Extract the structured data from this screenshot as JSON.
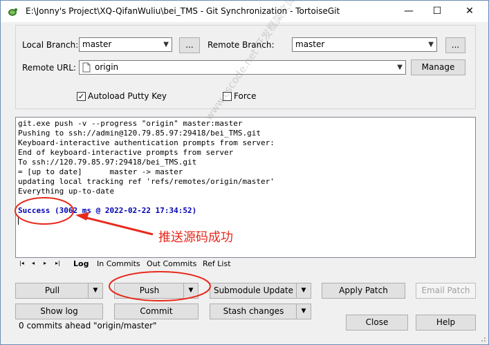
{
  "window": {
    "title": "E:\\Jonny's Project\\XQ-QifanWuliu\\bei_TMS - Git Synchronization - TortoiseGit",
    "minimize_glyph": "—",
    "maximize_glyph": "☐",
    "close_glyph": "✕"
  },
  "branch": {
    "local_label": "Local Branch:",
    "local_value": "master",
    "browse_label": "...",
    "remote_label": "Remote Branch:",
    "remote_value": "master",
    "remote_browse_label": "..."
  },
  "remote_url": {
    "label": "Remote URL:",
    "value": "origin",
    "manage_label": "Manage"
  },
  "options": {
    "autoload_label": "Autoload Putty Key",
    "autoload_checked": true,
    "force_label": "Force",
    "force_checked": false
  },
  "log": {
    "lines": [
      "git.exe push -v --progress \"origin\" master:master",
      "Pushing to ssh://admin@120.79.85.97:29418/bei_TMS.git",
      "Keyboard-interactive authentication prompts from server:",
      "End of keyboard-interactive prompts from server",
      "To ssh://120.79.85.97:29418/bei_TMS.git",
      "= [up to date]      master -> master",
      "updating local tracking ref 'refs/remotes/origin/master'",
      "Everything up-to-date"
    ],
    "success": "Success (3062 ms @ 2022-02-22 17:34:52)"
  },
  "tabs": [
    {
      "label": "Log",
      "active": true
    },
    {
      "label": "In Commits",
      "active": false
    },
    {
      "label": "Out Commits",
      "active": false
    },
    {
      "label": "Ref List",
      "active": false
    }
  ],
  "tab_nav": [
    "|◂",
    "◂",
    "▸",
    "▸|"
  ],
  "buttons": {
    "pull": "Pull",
    "push": "Push",
    "submodule_update": "Submodule Update",
    "apply_patch": "Apply Patch",
    "email_patch": "Email Patch",
    "show_log": "Show log",
    "commit": "Commit",
    "stash_changes": "Stash changes",
    "close": "Close",
    "help": "Help"
  },
  "status": "0 commits ahead \"origin/master\"",
  "annotation": {
    "text": "推送源码成功",
    "color": "#e8291c"
  },
  "watermark": "www.cscode.net 开发框架文库"
}
